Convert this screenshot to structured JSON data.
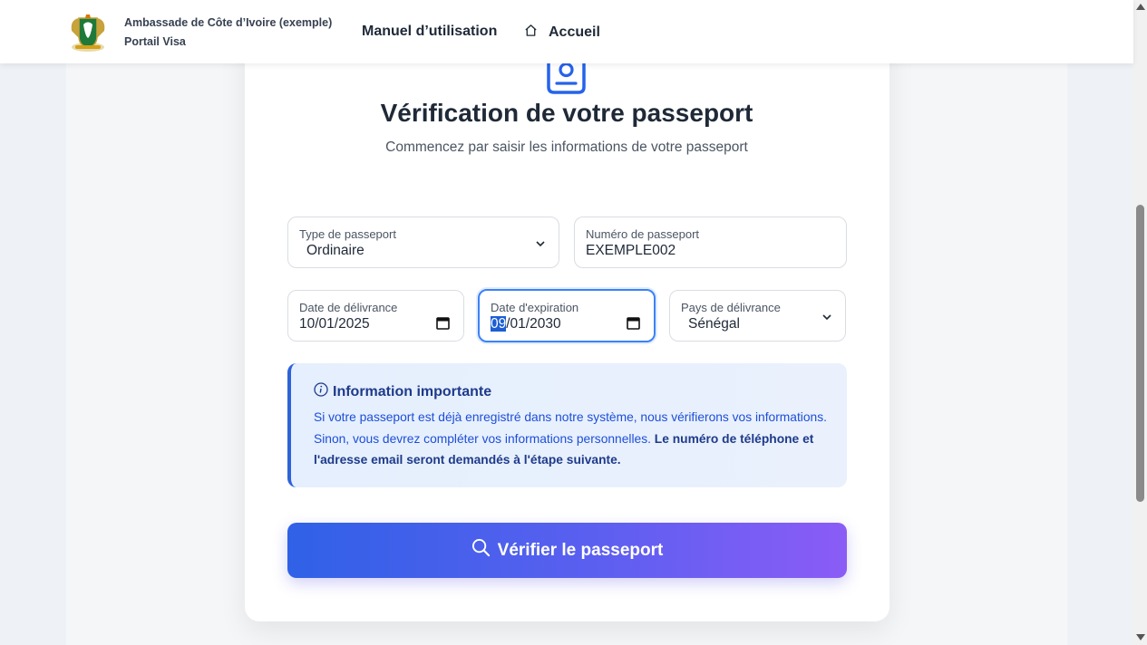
{
  "header": {
    "brand_line1": "Ambassade de Côte d’Ivoire (exemple)",
    "brand_line2": "Portail Visa",
    "nav_manual": "Manuel d’utilisation",
    "nav_home": "Accueil",
    "home_icon": "home-icon",
    "logo_icon": "coat-of-arms-logo"
  },
  "page": {
    "title": "Vérification de votre passeport",
    "subtitle": "Commencez par saisir les informations de votre passeport",
    "header_icon": "passport-icon"
  },
  "form": {
    "passport_type": {
      "label": "Type de passeport",
      "value": "Ordinaire",
      "icon": "chevron-down-icon"
    },
    "passport_number": {
      "label": "Numéro de passeport",
      "value": "EXEMPLE002"
    },
    "issue_date": {
      "label": "Date de délivrance",
      "value": "10/01/2025",
      "icon": "calendar-icon"
    },
    "expiry_date": {
      "label": "Date d'expiration",
      "value_selected": "09",
      "value_rest": "/01/2030",
      "icon": "calendar-icon"
    },
    "issuing_country": {
      "label": "Pays de délivrance",
      "value": "Sénégal",
      "icon": "chevron-down-icon"
    }
  },
  "info": {
    "title": "Information importante",
    "icon": "info-icon",
    "text": "Si votre passeport est déjà enregistré dans notre système, nous vérifierons vos informations. Sinon, vous devrez compléter vos informations personnelles. ",
    "text_bold": "Le numéro de téléphone et l'adresse email seront demandés à l'étape suivante."
  },
  "submit": {
    "label": "Vérifier le passeport",
    "icon": "search-icon"
  },
  "colors": {
    "accent": "#2d63d8",
    "button_gradient_start": "#2f61e6",
    "button_gradient_end": "#8b5cf6",
    "focus_border": "#3b82f6"
  }
}
